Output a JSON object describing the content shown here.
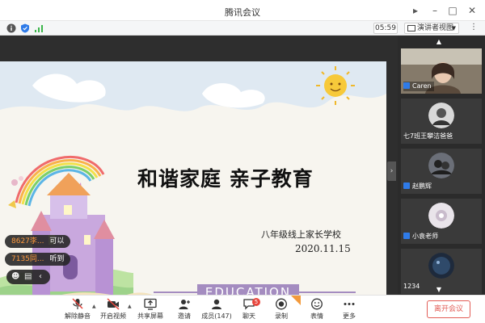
{
  "window": {
    "title": "腾讯会议"
  },
  "infobar": {
    "timer": "05:59",
    "view_label": "演讲者视图"
  },
  "slide": {
    "title": "和谐家庭 亲子教育",
    "subtitle": "八年级线上家长学校",
    "date": "2020.11.15",
    "banner": "EDUCATION"
  },
  "chat": [
    {
      "from": "8627李...",
      "text": "可以"
    },
    {
      "from": "7135同...",
      "text": "听到"
    }
  ],
  "participants": [
    {
      "name": "Caren"
    },
    {
      "name": "七7班王攀洁爸爸"
    },
    {
      "name": "赵鹏辉"
    },
    {
      "name": "小袁老师"
    },
    {
      "name": "1234"
    }
  ],
  "toolbar": {
    "buttons": [
      {
        "label": "解除静音"
      },
      {
        "label": "开启视频"
      },
      {
        "label": "共享屏幕"
      },
      {
        "label": "邀请"
      },
      {
        "label": "成员(147)"
      },
      {
        "label": "聊天",
        "badge": "5"
      },
      {
        "label": "录制"
      },
      {
        "label": "表情"
      },
      {
        "label": "更多"
      }
    ],
    "leave_label": "离开会议"
  },
  "colors": {
    "accent": "#2f7be8",
    "leave": "#e25c55",
    "banner": "#a48cc0"
  }
}
